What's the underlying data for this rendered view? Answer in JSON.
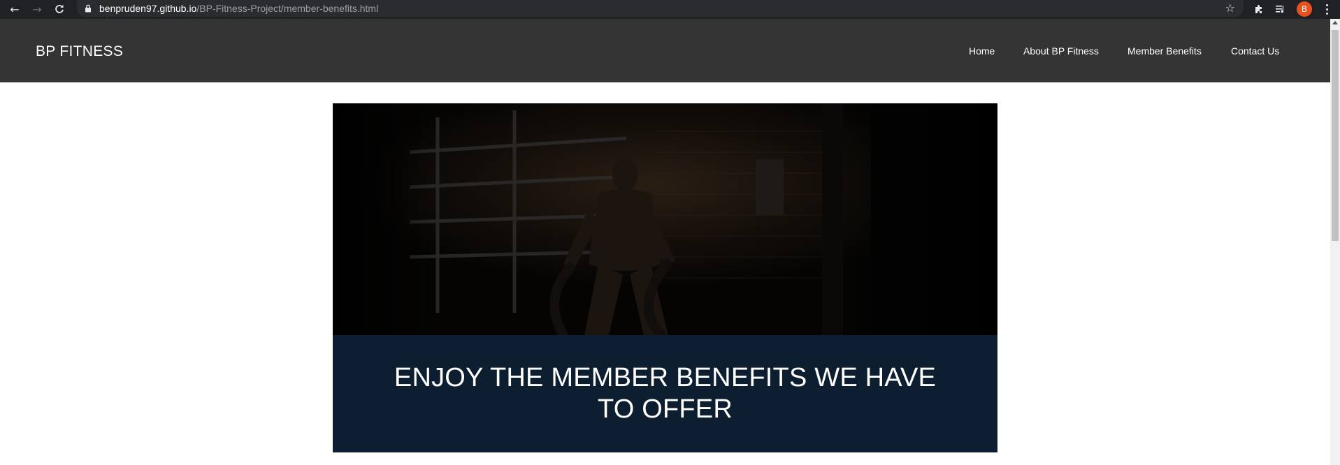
{
  "browser": {
    "url_host": "benpruden97.github.io",
    "url_path": "/BP-Fitness-Project/member-benefits.html",
    "avatar_letter": "B",
    "icons": [
      "back-icon",
      "forward-icon",
      "reload-icon",
      "lock-icon",
      "star-icon",
      "extensions-icon",
      "media-icon",
      "menu-icon"
    ]
  },
  "site": {
    "brand": "BP FITNESS",
    "nav": {
      "home": "Home",
      "about": "About BP Fitness",
      "benefits": "Member Benefits",
      "contact": "Contact Us"
    }
  },
  "hero": {
    "heading": "ENJOY THE MEMBER BENEFITS WE HAVE TO OFFER"
  },
  "colors": {
    "browser_bar": "#202124",
    "navbar": "#343434",
    "hero_caption_bg": "#0e1e31",
    "avatar": "#e8501f"
  }
}
